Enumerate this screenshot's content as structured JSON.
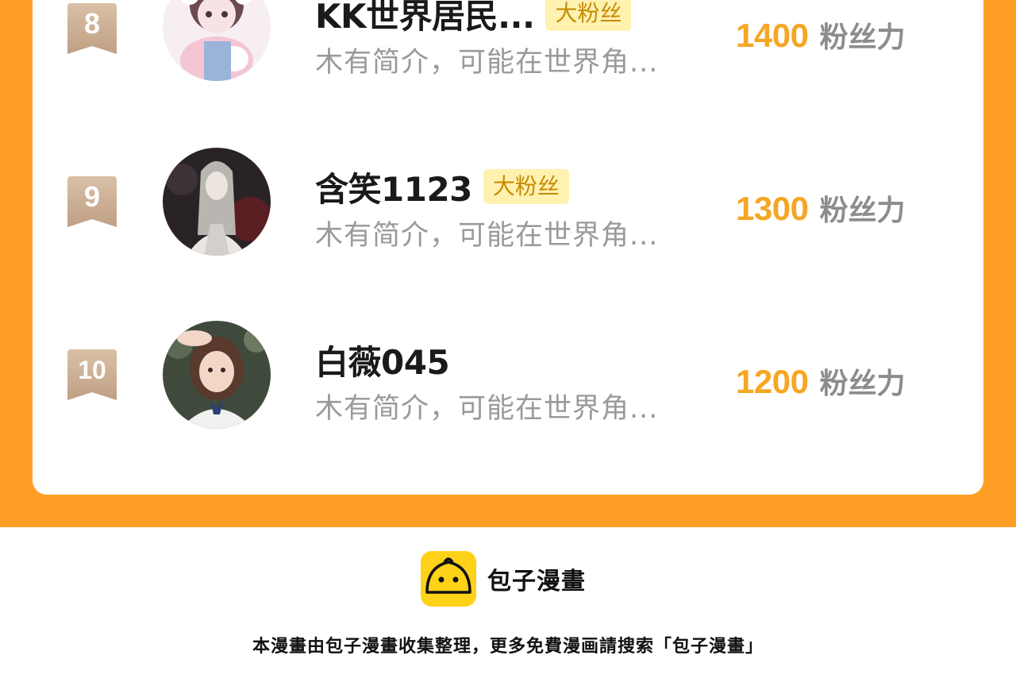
{
  "leaderboard": {
    "rows": [
      {
        "rank": "8",
        "name": "KK世界居民...",
        "badge": "大粉丝",
        "bio": "木有简介，可能在世界角...",
        "score": "1400",
        "unit": "粉丝力"
      },
      {
        "rank": "9",
        "name": "含笑1123",
        "badge": "大粉丝",
        "bio": "木有简介，可能在世界角...",
        "score": "1300",
        "unit": "粉丝力"
      },
      {
        "rank": "10",
        "name": "白薇045",
        "badge": "",
        "bio": "木有简介，可能在世界角...",
        "score": "1200",
        "unit": "粉丝力"
      }
    ]
  },
  "footer": {
    "logo_text": "包子漫畫",
    "note": "本漫畫由包子漫畫收集整理，更多免費漫画請搜索「包子漫畫」"
  },
  "colors": {
    "accent_orange": "#ff9e24",
    "score_gold": "#f5a623",
    "badge_bg": "#fff1b0",
    "rank_badge": "#c9ab8f",
    "logo_yellow": "#ffd21a"
  },
  "icons": {
    "rank": "ribbon-badge-icon",
    "logo": "bun-logo-icon"
  }
}
